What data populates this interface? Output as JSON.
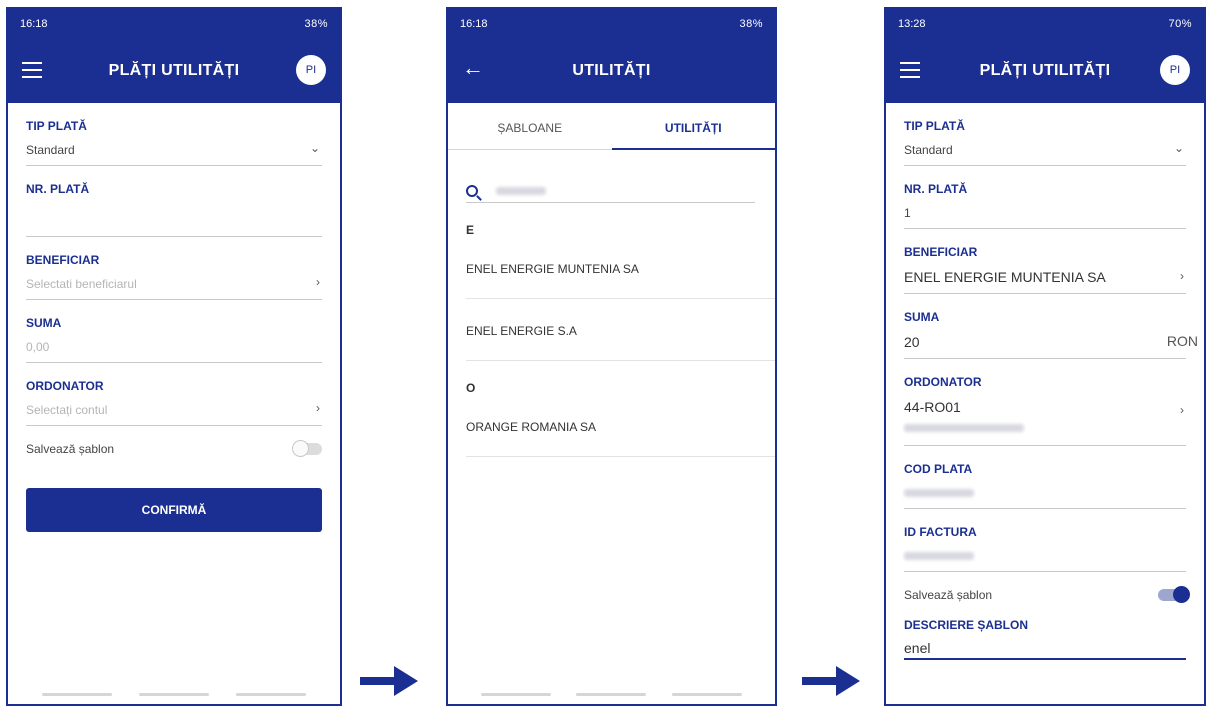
{
  "screen1": {
    "status": {
      "time": "16:18",
      "battery": "38%"
    },
    "title": "PLĂȚI UTILITĂȚI",
    "avatar": "PI",
    "fields": {
      "tip_plata": {
        "label": "TIP PLATĂ",
        "value": "Standard"
      },
      "nr_plata": {
        "label": "NR. PLATĂ",
        "value": ""
      },
      "beneficiar": {
        "label": "BENEFICIAR",
        "placeholder": "Selectati beneficiarul"
      },
      "suma": {
        "label": "SUMA",
        "placeholder": "0,00"
      },
      "ordonator": {
        "label": "ORDONATOR",
        "placeholder": "Selectați contul"
      }
    },
    "save_template": "Salvează șablon",
    "confirm": "CONFIRMĂ"
  },
  "screen2": {
    "status": {
      "time": "16:18",
      "battery": "38%"
    },
    "title": "UTILITĂȚI",
    "tabs": [
      "ȘABLOANE",
      "UTILITĂȚI"
    ],
    "groups": [
      {
        "letter": "E",
        "items": [
          "ENEL ENERGIE MUNTENIA SA",
          "ENEL ENERGIE S.A"
        ]
      },
      {
        "letter": "O",
        "items": [
          "ORANGE ROMANIA SA"
        ]
      }
    ]
  },
  "screen3": {
    "status": {
      "time": "13:28",
      "battery": "70%"
    },
    "title": "PLĂȚI UTILITĂȚI",
    "avatar": "PI",
    "fields": {
      "tip_plata": {
        "label": "TIP PLATĂ",
        "value": "Standard"
      },
      "nr_plata": {
        "label": "NR. PLATĂ",
        "value": "1"
      },
      "beneficiar": {
        "label": "BENEFICIAR",
        "value": "ENEL ENERGIE MUNTENIA SA"
      },
      "suma": {
        "label": "SUMA",
        "value": "20",
        "currency": "RON"
      },
      "ordonator": {
        "label": "ORDONATOR",
        "value": "44-RO01"
      },
      "cod_plata": {
        "label": "COD PLATA"
      },
      "id_factura": {
        "label": "ID FACTURA"
      },
      "descriere": {
        "label": "DESCRIERE ȘABLON",
        "value": "enel"
      }
    },
    "save_template": "Salvează șablon"
  },
  "colors": {
    "brand": "#1b2f92"
  }
}
